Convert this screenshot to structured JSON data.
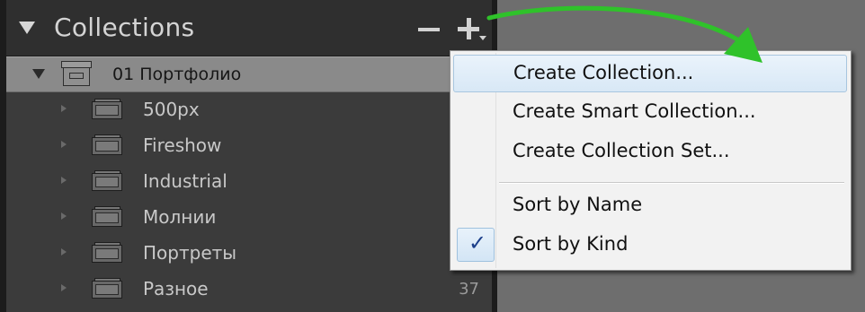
{
  "panel": {
    "title": "Collections",
    "selected_set": "01 Портфолио",
    "collections": [
      {
        "label": "500px",
        "count": ""
      },
      {
        "label": "Fireshow",
        "count": ""
      },
      {
        "label": "Industrial",
        "count": ""
      },
      {
        "label": "Молнии",
        "count": ""
      },
      {
        "label": "Портреты",
        "count": ""
      },
      {
        "label": "Разное",
        "count": "37"
      }
    ]
  },
  "menu": {
    "items": [
      {
        "label": "Create Collection...",
        "highlighted": true
      },
      {
        "label": "Create Smart Collection...",
        "highlighted": false
      },
      {
        "label": "Create Collection Set...",
        "highlighted": false
      }
    ],
    "sort_items": [
      {
        "label": "Sort by Name",
        "checked": false
      },
      {
        "label": "Sort by Kind",
        "checked": true
      }
    ],
    "check_glyph": "✓"
  },
  "colors": {
    "panel_bg": "#3b3b3b",
    "selected_row": "#8a8a8a",
    "menu_bg": "#f2f2f2",
    "menu_highlight": "#d8e8f6",
    "annotation_arrow": "#2fc22a"
  },
  "icons": [
    "disclosure-triangle-icon",
    "collection-set-icon",
    "collection-icon",
    "minus-icon",
    "plus-icon",
    "checkmark-icon",
    "annotation-arrow"
  ]
}
